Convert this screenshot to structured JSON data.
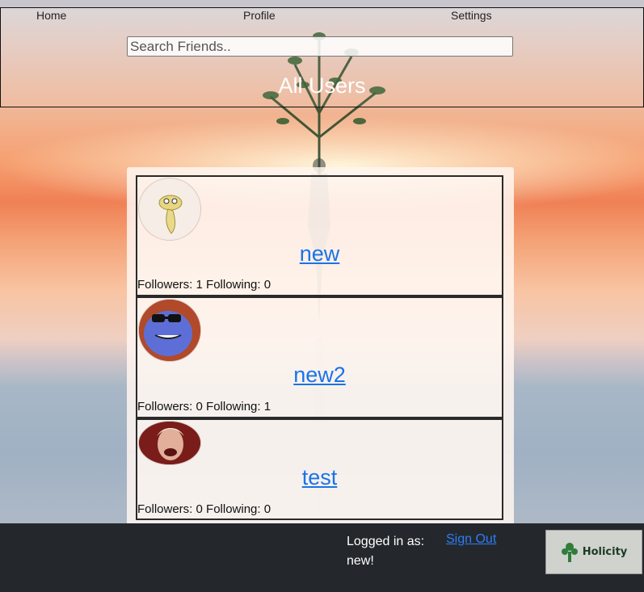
{
  "nav": {
    "home": "Home",
    "profile": "Profile",
    "settings": "Settings"
  },
  "search": {
    "placeholder": "Search Friends.."
  },
  "page_title": "All Users",
  "users": [
    {
      "name": "new",
      "stats": "Followers: 1 Following: 0",
      "avatar": "cartoon-creature-icon"
    },
    {
      "name": "new2",
      "stats": "Followers: 0 Following: 1",
      "avatar": "blue-cartoon-with-sunglasses-icon"
    },
    {
      "name": "test",
      "stats": "Followers: 0 Following: 0",
      "avatar": "man-photo-icon"
    }
  ],
  "footer": {
    "logged_in_label": "Logged in as:",
    "username": "new!",
    "sign_out": "Sign Out",
    "logo_text": "Holicity"
  },
  "colors": {
    "link": "#1a73e8",
    "footer_bg": "#24282c"
  }
}
